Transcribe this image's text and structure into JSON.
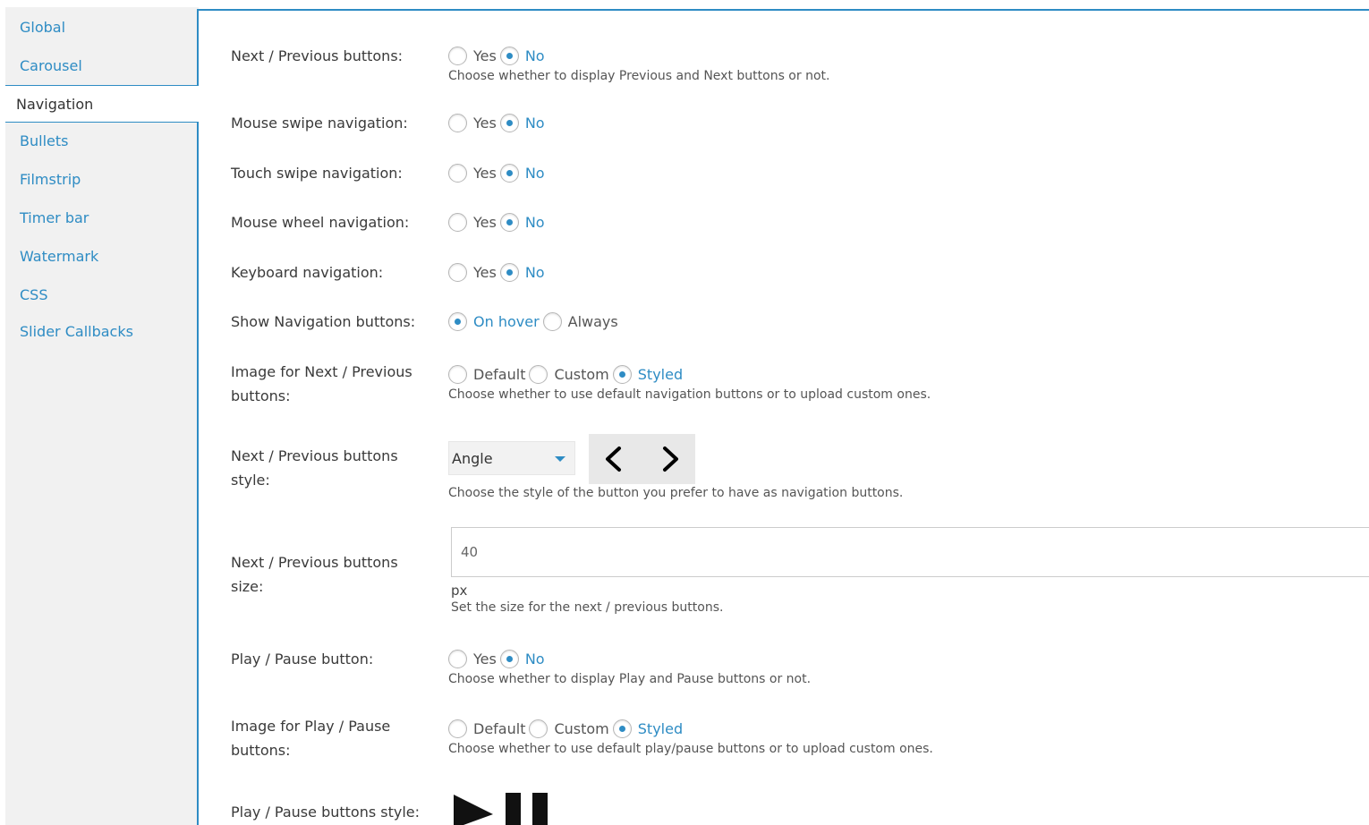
{
  "sidebar": {
    "items": [
      {
        "label": "Global"
      },
      {
        "label": "Carousel"
      },
      {
        "label": "Navigation"
      },
      {
        "label": "Bullets"
      },
      {
        "label": "Filmstrip"
      },
      {
        "label": "Timer bar"
      },
      {
        "label": "Watermark"
      },
      {
        "label": "CSS"
      },
      {
        "label": "Slider Callbacks"
      }
    ],
    "active": "Navigation"
  },
  "settings": {
    "next_prev": {
      "label": "Next / Previous buttons:",
      "options": [
        "Yes",
        "No"
      ],
      "selected": "No",
      "help": "Choose whether to display Previous and Next buttons or not."
    },
    "mouse_swipe": {
      "label": "Mouse swipe navigation:",
      "options": [
        "Yes",
        "No"
      ],
      "selected": "No"
    },
    "touch_swipe": {
      "label": "Touch swipe navigation:",
      "options": [
        "Yes",
        "No"
      ],
      "selected": "No"
    },
    "mouse_wheel": {
      "label": "Mouse wheel navigation:",
      "options": [
        "Yes",
        "No"
      ],
      "selected": "No"
    },
    "keyboard": {
      "label": "Keyboard navigation:",
      "options": [
        "Yes",
        "No"
      ],
      "selected": "No"
    },
    "show_nav": {
      "label": "Show Navigation buttons:",
      "options": [
        "On hover",
        "Always"
      ],
      "selected": "On hover"
    },
    "image_next_prev": {
      "label": "Image for Next / Previous buttons:",
      "options": [
        "Default",
        "Custom",
        "Styled"
      ],
      "selected": "Styled",
      "help": "Choose whether to use default navigation buttons or to upload custom ones."
    },
    "nav_style": {
      "label": "Next / Previous buttons style:",
      "value": "Angle",
      "help": "Choose the style of the button you prefer to have as navigation buttons."
    },
    "nav_size": {
      "label": "Next / Previous buttons size:",
      "value": "40",
      "unit": "px",
      "help": "Set the size for the next / previous buttons."
    },
    "play_pause": {
      "label": "Play / Pause button:",
      "options": [
        "Yes",
        "No"
      ],
      "selected": "No",
      "help": "Choose whether to display Play and Pause buttons or not."
    },
    "image_play_pause": {
      "label": "Image for Play / Pause buttons:",
      "options": [
        "Default",
        "Custom",
        "Styled"
      ],
      "selected": "Styled",
      "help": "Choose whether to use default play/pause buttons or to upload custom ones."
    },
    "play_pause_style": {
      "label": "Play / Pause buttons style:"
    }
  },
  "colors": {
    "accent": "#2e8cc4",
    "sidebar_bg": "#f1f1f1",
    "text": "#3a3a3a"
  },
  "icons": [
    "chevron-left-icon",
    "chevron-right-icon",
    "dropdown-caret-icon",
    "play-icon",
    "pause-icon"
  ]
}
